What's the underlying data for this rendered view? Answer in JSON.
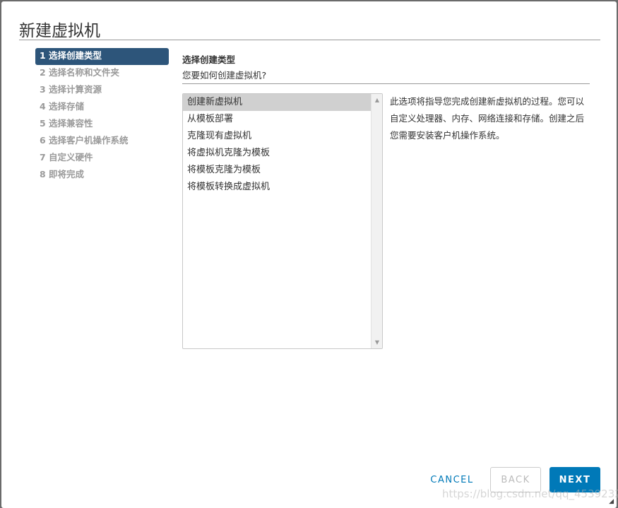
{
  "dialog": {
    "title": "新建虚拟机"
  },
  "steps": [
    "1 选择创建类型",
    "2 选择名称和文件夹",
    "3 选择计算资源",
    "4 选择存储",
    "5 选择兼容性",
    "6 选择客户机操作系统",
    "7 自定义硬件",
    "8 即将完成"
  ],
  "main": {
    "heading": "选择创建类型",
    "question": "您要如何创建虚拟机?",
    "options": [
      "创建新虚拟机",
      "从模板部署",
      "克隆现有虚拟机",
      "将虚拟机克隆为模板",
      "将模板克隆为模板",
      "将模板转换成虚拟机"
    ],
    "selected": "创建新虚拟机",
    "description": "此选项将指导您完成创建新虚拟机的过程。您可以自定义处理器、内存、网络连接和存储。创建之后您需要安装客户机操作系统。"
  },
  "footer": {
    "cancel": "CANCEL",
    "back": "BACK",
    "next": "NEXT"
  },
  "watermark": "https://blog.csdn.net/qq_45392321",
  "colors": {
    "accent": "#0079b8",
    "active_step": "#2d557a"
  }
}
